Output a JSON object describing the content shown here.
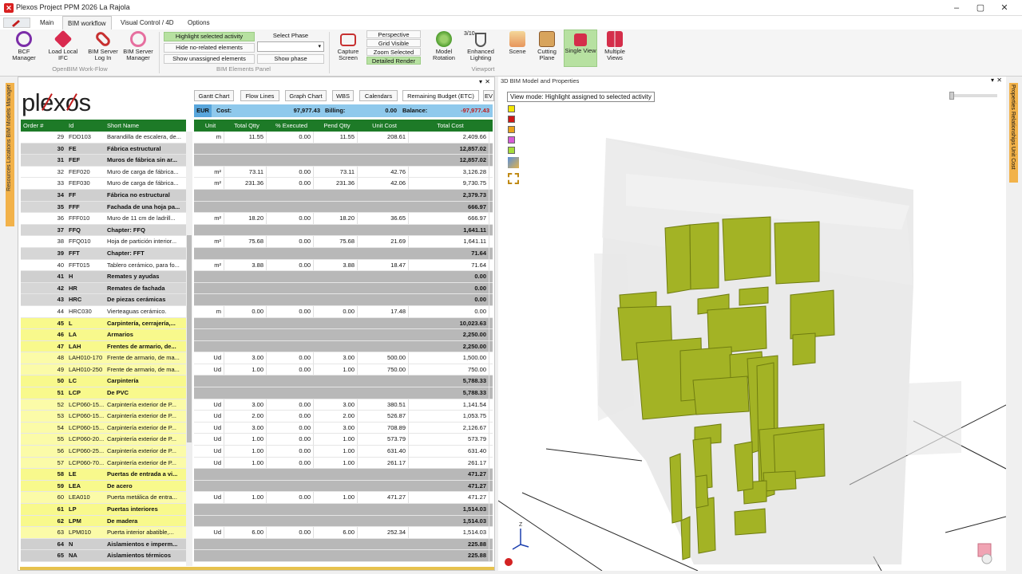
{
  "window": {
    "title": "Plexos Project PPM 2026 La Rajola"
  },
  "ribbon_tabs": [
    "Main",
    "BIM workflow",
    "Visual Control / 4D",
    "Options"
  ],
  "ribbon": {
    "openbim": [
      {
        "label": "BCF Manager",
        "icon": "bcf-icon"
      },
      {
        "label": "Load Local IFC",
        "icon": "ifc-icon"
      },
      {
        "label": "BIM Server Log In",
        "icon": "link-icon"
      },
      {
        "label": "BIM Server Manager",
        "icon": "server-icon"
      }
    ],
    "openbim_group": "OpenBIM Work-Flow",
    "elements": {
      "highlight": "Highlight selected activity",
      "hide": "Hide no-related elements",
      "show_unassigned": "Show unassigned elements",
      "select_phase": "Select Phase",
      "show_phase": "Show phase",
      "group": "BIM Elements Panel"
    },
    "capture": "Capture Screen",
    "view_toggles": [
      "Perspective",
      "Grid Visible",
      "Zoom Selected",
      "Detailed Render"
    ],
    "viewport": {
      "model_rotation": "Model Rotation",
      "enhanced_lighting": "Enhanced Lighting",
      "lighting_value": "3/10",
      "scene": "Scene",
      "cutting_plane": "Cutting Plane",
      "single_view": "Single View",
      "multiple_views": "Multiple Views",
      "group": "Viewport"
    }
  },
  "left_strip": "Resources  Locations  BIM Models Manager",
  "right_strip": "Properties  Relationships  Unit Cost",
  "left_panel": {
    "tabs": [
      "Gantt Chart",
      "Flow Lines",
      "Graph Chart",
      "WBS",
      "Calendars",
      "Remaining Budget (ETC)",
      "EV"
    ],
    "summary": {
      "currency": "EUR",
      "cost_label": "Cost:",
      "cost": "97,977.43",
      "billing_label": "Billing:",
      "billing": "0.00",
      "balance_label": "Balance:",
      "balance": "-97,977.43"
    },
    "tree_headers": [
      "Order #",
      "Id",
      "Short Name"
    ],
    "grid_headers": [
      "Unit",
      "Total Qtty",
      "% Executed",
      "Pend Qtty",
      "Unit Cost",
      "Total Cost"
    ],
    "rows": [
      {
        "o": "29",
        "id": "FDD103",
        "n": "Barandilla de escalera, de...",
        "t": "l3",
        "u": "m",
        "q": "11.55",
        "e": "0.00",
        "p": "11.55",
        "uc": "208.61",
        "tc": "2,409.66"
      },
      {
        "o": "30",
        "id": "FE",
        "n": "Fábrica estructural",
        "t": "l1",
        "tc": "12,857.02"
      },
      {
        "o": "31",
        "id": "FEF",
        "n": "Muros de fábrica sin ar...",
        "t": "l2",
        "tc": "12,857.02"
      },
      {
        "o": "32",
        "id": "FEF020",
        "n": "Muro de carga de fábrica...",
        "t": "l3",
        "u": "m²",
        "q": "73.11",
        "e": "0.00",
        "p": "73.11",
        "uc": "42.76",
        "tc": "3,126.28"
      },
      {
        "o": "33",
        "id": "FEF030",
        "n": "Muro de carga de fábrica...",
        "t": "l3",
        "u": "m²",
        "q": "231.36",
        "e": "0.00",
        "p": "231.36",
        "uc": "42.06",
        "tc": "9,730.75"
      },
      {
        "o": "34",
        "id": "FF",
        "n": "Fábrica no estructural",
        "t": "l1",
        "tc": "2,379.73"
      },
      {
        "o": "35",
        "id": "FFF",
        "n": "Fachada de una hoja pa...",
        "t": "l2",
        "tc": "666.97"
      },
      {
        "o": "36",
        "id": "FFF010",
        "n": "Muro de 11 cm de ladrill...",
        "t": "l3",
        "u": "m²",
        "q": "18.20",
        "e": "0.00",
        "p": "18.20",
        "uc": "36.65",
        "tc": "666.97"
      },
      {
        "o": "37",
        "id": "FFQ",
        "n": "Chapter: FFQ",
        "t": "l2",
        "tc": "1,641.11"
      },
      {
        "o": "38",
        "id": "FFQ010",
        "n": "Hoja de partición interior...",
        "t": "l3",
        "u": "m²",
        "q": "75.68",
        "e": "0.00",
        "p": "75.68",
        "uc": "21.69",
        "tc": "1,641.11"
      },
      {
        "o": "39",
        "id": "FFT",
        "n": "Chapter: FFT",
        "t": "l2",
        "tc": "71.64"
      },
      {
        "o": "40",
        "id": "FFT015",
        "n": "Tablero cerámico, para fo...",
        "t": "l3",
        "u": "m²",
        "q": "3.88",
        "e": "0.00",
        "p": "3.88",
        "uc": "18.47",
        "tc": "71.64"
      },
      {
        "o": "41",
        "id": "H",
        "n": "Remates y ayudas",
        "t": "l1",
        "tc": "0.00"
      },
      {
        "o": "42",
        "id": "HR",
        "n": "Remates de fachada",
        "t": "l2",
        "tc": "0.00"
      },
      {
        "o": "43",
        "id": "HRC",
        "n": "De piezas cerámicas",
        "t": "l2",
        "tc": "0.00"
      },
      {
        "o": "44",
        "id": "HRC030",
        "n": "Vierteaguas cerámico.",
        "t": "l3",
        "u": "m",
        "q": "0.00",
        "e": "0.00",
        "p": "0.00",
        "uc": "17.48",
        "tc": "0.00"
      },
      {
        "o": "45",
        "id": "L",
        "n": "Carpintería, cerrajería,...",
        "t": "yb",
        "tc": "10,023.63"
      },
      {
        "o": "46",
        "id": "LA",
        "n": "Armarios",
        "t": "yb",
        "tc": "2,250.00"
      },
      {
        "o": "47",
        "id": "LAH",
        "n": "Frentes de armario, de...",
        "t": "yb",
        "tc": "2,250.00"
      },
      {
        "o": "48",
        "id": "LAH010-170",
        "n": "Frente de armario, de ma...",
        "t": "yl",
        "u": "Ud",
        "q": "3.00",
        "e": "0.00",
        "p": "3.00",
        "uc": "500.00",
        "tc": "1,500.00"
      },
      {
        "o": "49",
        "id": "LAH010-250",
        "n": "Frente de armario, de ma...",
        "t": "yl",
        "u": "Ud",
        "q": "1.00",
        "e": "0.00",
        "p": "1.00",
        "uc": "750.00",
        "tc": "750.00"
      },
      {
        "o": "50",
        "id": "LC",
        "n": "Carpintería",
        "t": "yb",
        "tc": "5,788.33"
      },
      {
        "o": "51",
        "id": "LCP",
        "n": "De PVC",
        "t": "yb",
        "tc": "5,788.33"
      },
      {
        "o": "52",
        "id": "LCP060-15...",
        "n": "Carpintería exterior de P...",
        "t": "yl",
        "u": "Ud",
        "q": "3.00",
        "e": "0.00",
        "p": "3.00",
        "uc": "380.51",
        "tc": "1,141.54"
      },
      {
        "o": "53",
        "id": "LCP060-15...",
        "n": "Carpintería exterior de P...",
        "t": "yl",
        "u": "Ud",
        "q": "2.00",
        "e": "0.00",
        "p": "2.00",
        "uc": "526.87",
        "tc": "1,053.75"
      },
      {
        "o": "54",
        "id": "LCP060-15...",
        "n": "Carpintería exterior de P...",
        "t": "yl",
        "u": "Ud",
        "q": "3.00",
        "e": "0.00",
        "p": "3.00",
        "uc": "708.89",
        "tc": "2,126.67"
      },
      {
        "o": "55",
        "id": "LCP060-20...",
        "n": "Carpintería exterior de P...",
        "t": "yl",
        "u": "Ud",
        "q": "1.00",
        "e": "0.00",
        "p": "1.00",
        "uc": "573.79",
        "tc": "573.79"
      },
      {
        "o": "56",
        "id": "LCP060-25...",
        "n": "Carpintería exterior de P...",
        "t": "yl",
        "u": "Ud",
        "q": "1.00",
        "e": "0.00",
        "p": "1.00",
        "uc": "631.40",
        "tc": "631.40"
      },
      {
        "o": "57",
        "id": "LCP060-70...",
        "n": "Carpintería exterior de P...",
        "t": "yl",
        "u": "Ud",
        "q": "1.00",
        "e": "0.00",
        "p": "1.00",
        "uc": "261.17",
        "tc": "261.17"
      },
      {
        "o": "58",
        "id": "LE",
        "n": "Puertas de entrada a vi...",
        "t": "yb",
        "tc": "471.27"
      },
      {
        "o": "59",
        "id": "LEA",
        "n": "De acero",
        "t": "yb",
        "tc": "471.27"
      },
      {
        "o": "60",
        "id": "LEA010",
        "n": "Puerta metálica de entra...",
        "t": "yl",
        "u": "Ud",
        "q": "1.00",
        "e": "0.00",
        "p": "1.00",
        "uc": "471.27",
        "tc": "471.27"
      },
      {
        "o": "61",
        "id": "LP",
        "n": "Puertas interiores",
        "t": "yb",
        "tc": "1,514.03"
      },
      {
        "o": "62",
        "id": "LPM",
        "n": "De madera",
        "t": "yb",
        "tc": "1,514.03"
      },
      {
        "o": "63",
        "id": "LPM010",
        "n": "Puerta interior abatible,...",
        "t": "yl",
        "u": "Ud",
        "q": "6.00",
        "e": "0.00",
        "p": "6.00",
        "uc": "252.34",
        "tc": "1,514.03"
      },
      {
        "o": "64",
        "id": "N",
        "n": "Aislamientos e imperm...",
        "t": "l1",
        "tc": "225.88"
      },
      {
        "o": "65",
        "id": "NA",
        "n": "Aislamientos térmicos",
        "t": "l1",
        "tc": "225.88"
      }
    ]
  },
  "right_panel": {
    "title": "3D BIM Model and Properties",
    "view_mode": "View mode: Highlight assigned to selected activity",
    "legend_colors": [
      "#f3e600",
      "#d01616",
      "#e8a21a",
      "#d65ad6",
      "#a6dd39"
    ],
    "axis_label": "Z"
  }
}
